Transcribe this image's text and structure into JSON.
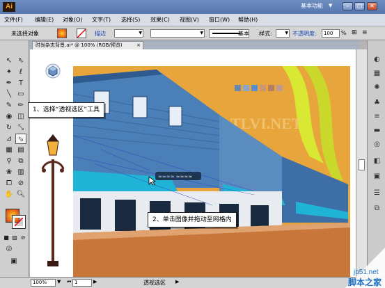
{
  "app": {
    "logo": "Ai",
    "workspace": "基本功能"
  },
  "window_controls": {
    "minimize": "–",
    "restore": "▢",
    "close": "✕"
  },
  "menu": {
    "items": [
      "文件(F)",
      "编辑(E)",
      "对象(O)",
      "文字(T)",
      "选择(S)",
      "效果(C)",
      "视图(V)",
      "窗口(W)",
      "帮助(H)"
    ]
  },
  "controlbar": {
    "selection_state": "未选择对象",
    "stroke_label": "描边",
    "brush_label": "基本",
    "style_label": "样式:",
    "opacity_label": "不透明度:",
    "opacity_value": "100",
    "opacity_unit": "%"
  },
  "document": {
    "tab_title": "时尚杂志背景.ai* @ 100% (RGB/预览)",
    "tab_close": "×"
  },
  "statusbar": {
    "zoom": "100%",
    "page": "1",
    "tool_status": "透视选区"
  },
  "callouts": {
    "step1": "1、选择“透视选区”工具",
    "step2": "2、单击图像并拖动至网格内"
  },
  "artwork": {
    "sign_text": "≈≈≈≈ ≈≈≈≈",
    "watermark_site": "TLVI.NET"
  },
  "watermark": {
    "site": "jb51.net",
    "name": "脚本之家"
  },
  "colors": {
    "sky": "#e8a53c",
    "building_blue": "#4a7fb8",
    "awning_cyan": "#1fb4d6",
    "street": "#c8763a",
    "accent_yellow": "#d9e832",
    "palette": [
      "#6a87b0",
      "#8aa6cc",
      "#5a8ed0",
      "#cf9470",
      "#b67e63",
      "#c19a8f"
    ]
  }
}
